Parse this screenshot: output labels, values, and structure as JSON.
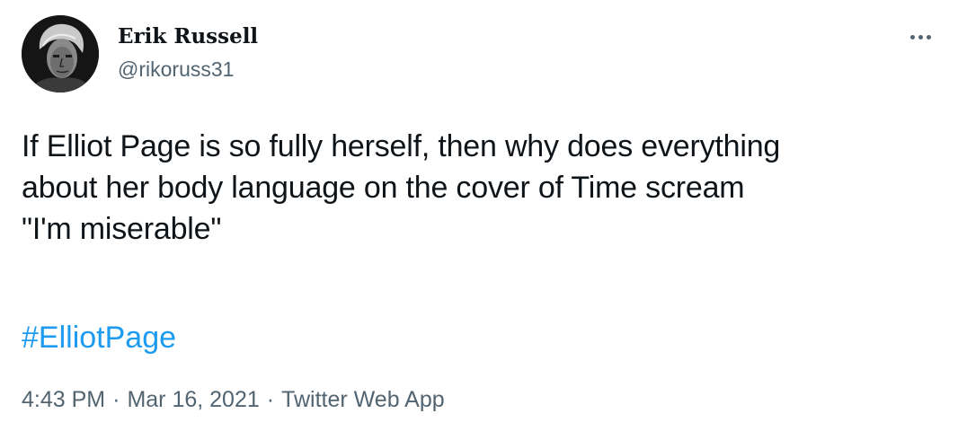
{
  "author": {
    "display_name": "Erik Russell",
    "handle": "@rikoruss31",
    "avatar_icon": "person-portrait"
  },
  "more_icon": "ellipsis-icon",
  "tweet": {
    "lines": [
      "If Elliot Page is so fully herself, then why does everything",
      "about her body language on the cover of Time scream",
      "\"I'm miserable\""
    ],
    "hashtag": "#ElliotPage"
  },
  "meta": {
    "time": "4:43 PM",
    "separator": "·",
    "date": "Mar 16, 2021",
    "source": "Twitter Web App"
  },
  "colors": {
    "text": "#0f1419",
    "secondary": "#536471",
    "link": "#1d9bf0",
    "background": "#ffffff"
  }
}
